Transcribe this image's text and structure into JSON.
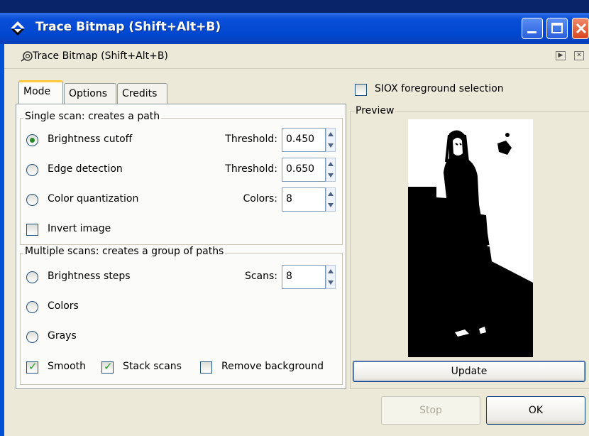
{
  "window": {
    "title": "Trace Bitmap (Shift+Alt+B)",
    "dock_title": "Trace Bitmap (Shift+Alt+B)"
  },
  "tabs": [
    {
      "label": "Mode",
      "active": true
    },
    {
      "label": "Options",
      "active": false
    },
    {
      "label": "Credits",
      "active": false
    }
  ],
  "single_scan": {
    "group_label": "Single scan: creates a path",
    "brightness": {
      "label": "Brightness cutoff",
      "checked": true,
      "spin_label": "Threshold:",
      "value": "0.450"
    },
    "edge": {
      "label": "Edge detection",
      "checked": false,
      "spin_label": "Threshold:",
      "value": "0.650"
    },
    "color_quant": {
      "label": "Color quantization",
      "checked": false,
      "spin_label": "Colors:",
      "value": "8"
    },
    "invert": {
      "label": "Invert image",
      "checked": false
    }
  },
  "multi_scan": {
    "group_label": "Multiple scans: creates a group of paths",
    "brightness_steps": {
      "label": "Brightness steps",
      "checked": false,
      "spin_label": "Scans:",
      "value": "8"
    },
    "colors": {
      "label": "Colors",
      "checked": false
    },
    "grays": {
      "label": "Grays",
      "checked": false
    },
    "smooth": {
      "label": "Smooth",
      "checked": true
    },
    "stack": {
      "label": "Stack scans",
      "checked": true
    },
    "remove_bg": {
      "label": "Remove background",
      "checked": false
    }
  },
  "siox": {
    "label": "SIOX foreground selection",
    "checked": false
  },
  "preview": {
    "label": "Preview",
    "update_label": "Update"
  },
  "buttons": {
    "stop_label": "Stop",
    "ok_label": "OK"
  },
  "colors": {
    "titlebar": "#0047d0",
    "dialog_bg": "#ece9d8",
    "tab_highlight": "#ffc83c",
    "check_green": "#21a121"
  }
}
